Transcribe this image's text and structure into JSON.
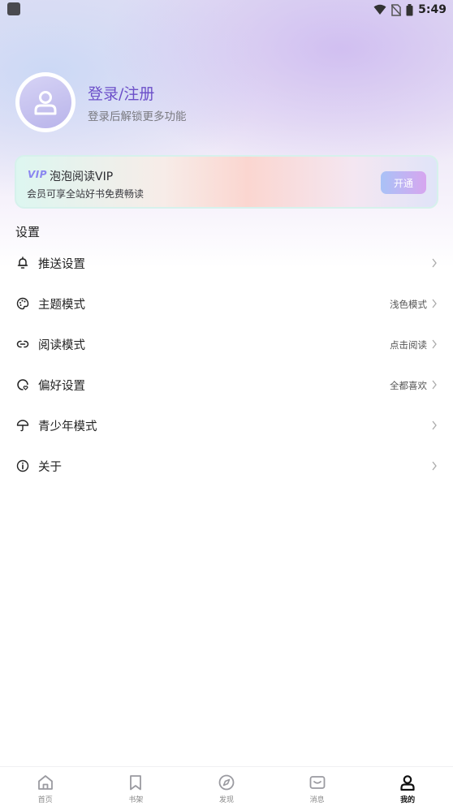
{
  "status_bar": {
    "time": "5:49"
  },
  "profile": {
    "title": "登录/注册",
    "subtitle": "登录后解锁更多功能"
  },
  "vip": {
    "badge": "VIP",
    "title": "泡泡阅读VIP",
    "subtitle": "会员可享全站好书免费畅读",
    "button": "开通"
  },
  "settings": {
    "title": "设置",
    "items": [
      {
        "label": "推送设置",
        "value": "",
        "icon": "bell-icon"
      },
      {
        "label": "主题模式",
        "value": "浅色模式",
        "icon": "palette-icon"
      },
      {
        "label": "阅读模式",
        "value": "点击阅读",
        "icon": "loop-icon"
      },
      {
        "label": "偏好设置",
        "value": "全都喜欢",
        "icon": "preference-icon"
      },
      {
        "label": "青少年模式",
        "value": "",
        "icon": "umbrella-icon"
      },
      {
        "label": "关于",
        "value": "",
        "icon": "info-icon"
      }
    ]
  },
  "tabbar": {
    "items": [
      {
        "label": "首页",
        "icon": "home-icon"
      },
      {
        "label": "书架",
        "icon": "bookmark-icon"
      },
      {
        "label": "发现",
        "icon": "compass-icon"
      },
      {
        "label": "消息",
        "icon": "message-icon"
      },
      {
        "label": "我的",
        "icon": "user-icon",
        "active": true
      }
    ]
  },
  "colors": {
    "accent": "#6c4fc9",
    "vip_button_from": "#a9c2f7",
    "vip_button_to": "#d7a6ef"
  }
}
